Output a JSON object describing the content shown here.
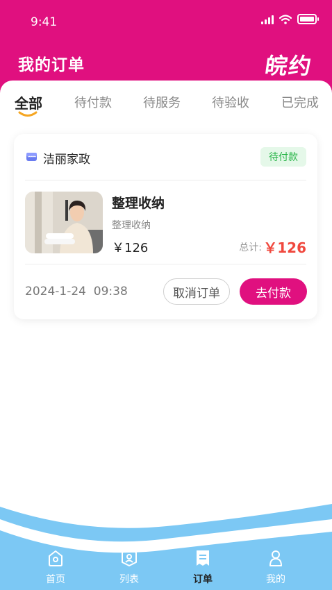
{
  "status_bar": {
    "time": "9:41"
  },
  "header": {
    "title": "我的订单",
    "brand": "皖约",
    "color": "#e0107f"
  },
  "tabs": [
    {
      "label": "全部",
      "active": true
    },
    {
      "label": "待付款",
      "active": false
    },
    {
      "label": "待服务",
      "active": false
    },
    {
      "label": "待验收",
      "active": false
    },
    {
      "label": "已完成",
      "active": false
    }
  ],
  "order": {
    "store_name": "洁丽家政",
    "store_icon": "shop-icon",
    "status": "待付款",
    "service_name": "整理收纳",
    "service_sub": "整理收纳",
    "unit_price": "￥126",
    "total_label": "总计:",
    "total_value": "￥126",
    "order_time": "2024-1-24  09:38",
    "cancel_label": "取消订单",
    "pay_label": "去付款"
  },
  "bottom_nav": [
    {
      "label": "首页",
      "icon": "home-icon",
      "active": false
    },
    {
      "label": "列表",
      "icon": "list-icon",
      "active": false
    },
    {
      "label": "订单",
      "icon": "order-icon",
      "active": true
    },
    {
      "label": "我的",
      "icon": "profile-icon",
      "active": false
    }
  ],
  "colors": {
    "accent": "#e0107f",
    "price": "#f0483e",
    "badge_text": "#27b447",
    "nav_bg": "#7cc8f4"
  }
}
